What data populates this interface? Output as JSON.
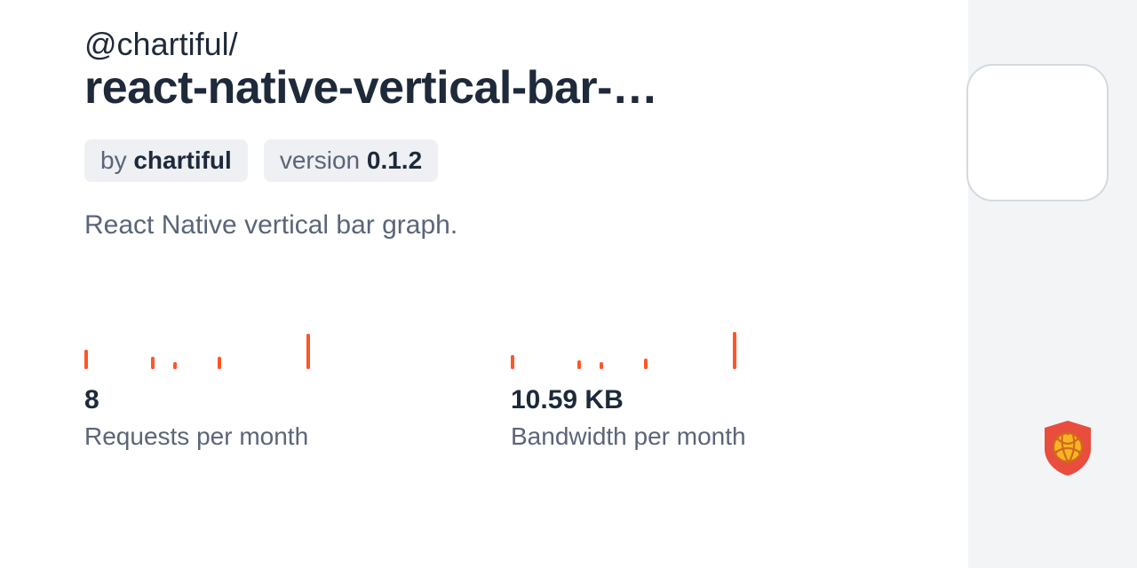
{
  "package": {
    "scope": "@chartiful/",
    "name": "react-native-vertical-bar-graph"
  },
  "badges": {
    "author_prefix": "by ",
    "author": "chartiful",
    "version_prefix": "version ",
    "version": "0.1.2"
  },
  "description": "React Native vertical bar graph.",
  "stats": {
    "requests": {
      "value": "8",
      "label": "Requests per month",
      "bars": [
        22,
        0,
        0,
        14,
        8,
        0,
        14,
        0,
        0,
        0,
        40
      ]
    },
    "bandwidth": {
      "value": "10.59 KB",
      "label": "Bandwidth per month",
      "bars": [
        16,
        0,
        0,
        10,
        8,
        0,
        12,
        0,
        0,
        0,
        42
      ]
    }
  }
}
